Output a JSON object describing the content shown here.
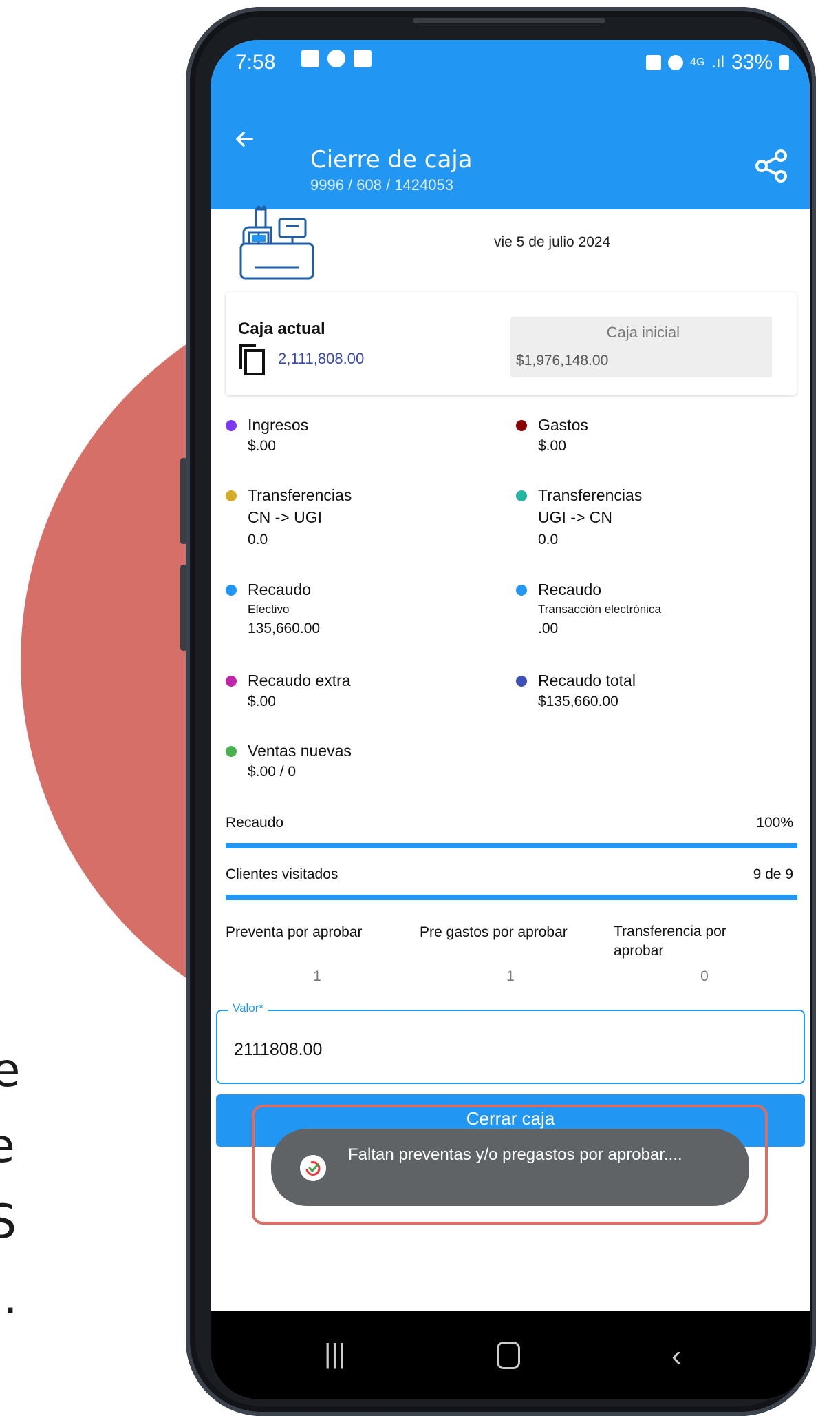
{
  "background_text": {
    "lines": [
      "te",
      "le",
      "IS",
      "S."
    ]
  },
  "statusbar": {
    "time": "7:58",
    "battery": "33%",
    "signal_text": "4G"
  },
  "appbar": {
    "title": "Cierre de caja",
    "subtitle": "9996 / 608 / 1424053"
  },
  "date": "vie 5 de julio 2024",
  "caja": {
    "actual_label": "Caja actual",
    "actual_value": "2,111,808.00",
    "inicial_label": "Caja inicial",
    "inicial_value": "$1,976,148.00"
  },
  "stats": {
    "ingresos": {
      "label": "Ingresos",
      "value": "$.00",
      "color": "#7c3aed"
    },
    "gastos": {
      "label": "Gastos",
      "value": "$.00",
      "color": "#8b0000"
    },
    "transf_cn_ugi": {
      "label": "Transferencias",
      "sub": "CN -> UGI",
      "value": "0.0",
      "color": "#d4ac28"
    },
    "transf_ugi_cn": {
      "label": "Transferencias",
      "sub": "UGI -> CN",
      "value": "0.0",
      "color": "#26b5a0"
    },
    "recaudo_efectivo": {
      "label": "Recaudo",
      "sub": "Efectivo",
      "value": "135,660.00",
      "color": "#2196f3"
    },
    "recaudo_electronico": {
      "label": "Recaudo",
      "sub": "Transacción electrónica",
      "value": ".00",
      "color": "#2196f3"
    },
    "recaudo_extra": {
      "label": "Recaudo extra",
      "value": "$.00",
      "color": "#c026a8"
    },
    "recaudo_total": {
      "label": "Recaudo total",
      "value": "$135,660.00",
      "color": "#3f51b5"
    },
    "ventas_nuevas": {
      "label": "Ventas nuevas",
      "value": "$.00 / 0",
      "color": "#4caf50"
    }
  },
  "progress": {
    "recaudo": {
      "label": "Recaudo",
      "value": "100%",
      "fraction": 1.0
    },
    "clientes": {
      "label": "Clientes visitados",
      "value": "9 de 9",
      "fraction": 1.0
    }
  },
  "pendientes": {
    "preventa": {
      "label": "Preventa por aprobar",
      "value": "1"
    },
    "pregastos": {
      "label": "Pre gastos por aprobar",
      "value": "1"
    },
    "transferencia": {
      "label": "Transferencia por aprobar",
      "value": "0"
    }
  },
  "valor_field": {
    "label": "Valor*",
    "value": "2111808.00"
  },
  "cerrar_button": "Cerrar caja",
  "toast": "Faltan preventas y/o pregastos por aprobar....",
  "colors": {
    "primary": "#2196f3",
    "accent_red": "#d66f67"
  }
}
